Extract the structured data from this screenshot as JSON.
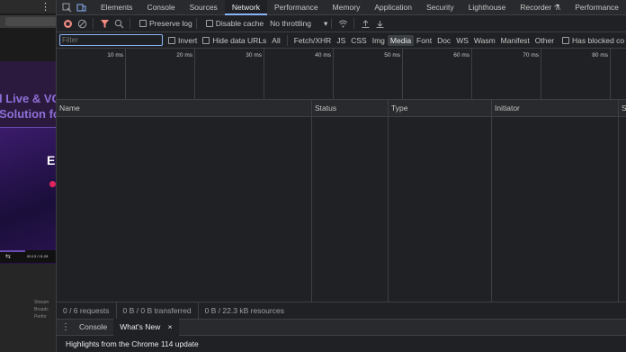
{
  "page": {
    "hero_line1": "l Live & VO",
    "hero_line2": "Solution fo",
    "video_letter": "E",
    "video_time": "00:13 / 01:28",
    "below_text1": "Stream",
    "below_text2": "Broadc",
    "below_text3": "Perfor"
  },
  "tabs": {
    "items": [
      "Elements",
      "Console",
      "Sources",
      "Network",
      "Performance",
      "Memory",
      "Application",
      "Security",
      "Lighthouse",
      "Recorder",
      "Performance"
    ],
    "active": "Network"
  },
  "toolbar": {
    "preserve_log": "Preserve log",
    "disable_cache": "Disable cache",
    "throttling": "No throttling"
  },
  "filterbar": {
    "filter_placeholder": "Filter",
    "invert": "Invert",
    "hide_data_urls": "Hide data URLs",
    "types": [
      "All",
      "Fetch/XHR",
      "JS",
      "CSS",
      "Img",
      "Media",
      "Font",
      "Doc",
      "WS",
      "Wasm",
      "Manifest",
      "Other"
    ],
    "active_type": "Media",
    "has_blocked": "Has blocked co"
  },
  "timeline": {
    "ticks": [
      "10 ms",
      "20 ms",
      "30 ms",
      "40 ms",
      "50 ms",
      "60 ms",
      "70 ms",
      "80 ms"
    ]
  },
  "grid": {
    "columns": [
      "Name",
      "Status",
      "Type",
      "Initiator",
      "Si"
    ]
  },
  "status": {
    "requests": "0 / 6 requests",
    "transferred": "0 B / 0 B transferred",
    "resources": "0 B / 22.3 kB resources"
  },
  "drawer": {
    "tab_console": "Console",
    "tab_whats_new": "What's New",
    "close": "×",
    "body_text": "Highlights from the Chrome 114 update"
  },
  "colors": {
    "accent": "#8ab4f8",
    "record": "#f28b82",
    "panel_bg": "#202124",
    "toolbar_bg": "#292a2d"
  }
}
